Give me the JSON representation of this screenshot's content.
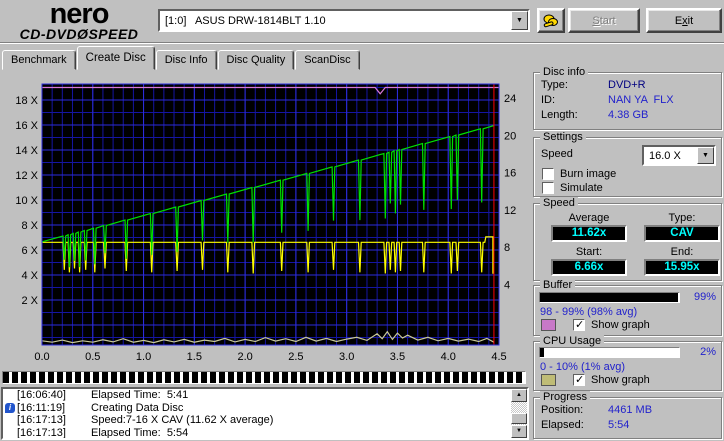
{
  "toolbar": {
    "logo_line1": "nero",
    "logo_line2_left": "CD-DVD",
    "logo_disc_glyph": "Ø",
    "logo_line2_right": "SPEED",
    "drive_select_value": "[1:0]   ASUS DRW-1814BLT 1.10",
    "dropdown_arrow": "▼",
    "start_underline": "S",
    "start_rest": "tart",
    "exit_prefix": "E",
    "exit_underline": "x",
    "exit_rest": "it"
  },
  "tabs": [
    {
      "label": "Benchmark",
      "active": false
    },
    {
      "label": "Create Disc",
      "active": true
    },
    {
      "label": "Disc Info",
      "active": false
    },
    {
      "label": "Disc Quality",
      "active": false
    },
    {
      "label": "ScanDisc",
      "active": false
    }
  ],
  "chart_data": {
    "type": "line",
    "title": "",
    "x_range": [
      0,
      4.5
    ],
    "x_unit": "GB",
    "x_ticks": [
      [
        0,
        "0.0"
      ],
      [
        0.5,
        "0.5"
      ],
      [
        1,
        "1.0"
      ],
      [
        1.5,
        "1.5"
      ],
      [
        2,
        "2.0"
      ],
      [
        2.5,
        "2.5"
      ],
      [
        3,
        "3.0"
      ],
      [
        3.5,
        "3.5"
      ],
      [
        4,
        "4.0"
      ],
      [
        4.5,
        "4.5"
      ]
    ],
    "left_ticks": [
      [
        2,
        "2 X"
      ],
      [
        4,
        "4 X"
      ],
      [
        6,
        "6 X"
      ],
      [
        8,
        "8 X"
      ],
      [
        10,
        "10 X"
      ],
      [
        12,
        "12 X"
      ],
      [
        14,
        "14 X"
      ],
      [
        16,
        "16 X"
      ],
      [
        18,
        "18 X"
      ]
    ],
    "right_ticks": [
      [
        4,
        "4"
      ],
      [
        8,
        "8"
      ],
      [
        12,
        "12"
      ],
      [
        16,
        "16"
      ],
      [
        20,
        "20"
      ],
      [
        24,
        "24"
      ]
    ],
    "grid": {
      "bg": "#000000",
      "minor_x": 0.1,
      "major_x": 0.5,
      "minor_y": 1,
      "major_y": 2,
      "minor_color": "#1515a2",
      "major_color": "#2d2dde"
    },
    "marker": {
      "x": 4.45,
      "color": "#ff0000"
    },
    "series": [
      {
        "name": "write-speed",
        "color": "#00e000",
        "base_start": [
          0,
          6.66
        ],
        "base_end": [
          4.45,
          15.95
        ],
        "dips": [
          [
            0.22,
            1.9
          ],
          [
            0.27,
            2.6
          ],
          [
            0.32,
            2.2
          ],
          [
            0.37,
            2.8
          ],
          [
            0.43,
            2.4
          ],
          [
            0.52,
            2.9
          ],
          [
            0.62,
            2.2
          ],
          [
            0.83,
            3.1
          ],
          [
            1.08,
            3.3
          ],
          [
            1.33,
            3.6
          ],
          [
            1.58,
            3.2
          ],
          [
            1.83,
            3.9
          ],
          [
            2.08,
            4.4
          ],
          [
            2.36,
            4.2
          ],
          [
            2.62,
            4.6
          ],
          [
            2.87,
            4.3
          ],
          [
            3.13,
            4.8
          ],
          [
            3.38,
            5.2
          ],
          [
            3.43,
            4.1
          ],
          [
            3.48,
            5.0
          ],
          [
            3.53,
            4.4
          ],
          [
            3.76,
            5.3
          ],
          [
            4.03,
            5.8
          ],
          [
            4.09,
            5.2
          ],
          [
            4.33,
            5.9
          ]
        ],
        "tail": []
      },
      {
        "name": "reference-speed",
        "color": "#ffff00",
        "base_start": [
          0,
          6.62
        ],
        "base_end": [
          4.36,
          6.62
        ],
        "dips": [
          [
            0.22,
            2.2
          ],
          [
            0.27,
            2.4
          ],
          [
            0.32,
            2.1
          ],
          [
            0.37,
            2.4
          ],
          [
            0.43,
            2.2
          ],
          [
            0.52,
            2.4
          ],
          [
            0.62,
            2.1
          ],
          [
            0.83,
            2.3
          ],
          [
            1.08,
            2.4
          ],
          [
            1.33,
            2.3
          ],
          [
            1.58,
            2.2
          ],
          [
            1.83,
            2.4
          ],
          [
            2.08,
            2.5
          ],
          [
            2.36,
            2.3
          ],
          [
            2.62,
            2.4
          ],
          [
            2.87,
            2.2
          ],
          [
            3.13,
            2.4
          ],
          [
            3.38,
            2.5
          ],
          [
            3.43,
            2.2
          ],
          [
            3.48,
            2.4
          ],
          [
            3.53,
            2.3
          ],
          [
            3.76,
            2.4
          ],
          [
            4.03,
            2.5
          ],
          [
            4.09,
            2.3
          ],
          [
            4.33,
            2.4
          ]
        ],
        "tail": [
          [
            4.37,
            7.05
          ],
          [
            4.44,
            7.05
          ],
          [
            4.44,
            4.1
          ]
        ]
      }
    ],
    "buffer_series": {
      "name": "buffer-level",
      "color": "#d878d8",
      "points": [
        [
          0,
          19.0
        ],
        [
          3.28,
          19.0
        ],
        [
          3.33,
          18.5
        ],
        [
          3.38,
          19.0
        ],
        [
          4.5,
          19.0
        ]
      ]
    },
    "cpu_series": {
      "name": "cpu-usage",
      "color": "#c8c89a",
      "unit": "%",
      "points": [
        [
          0,
          1.2
        ],
        [
          0.1,
          0.8
        ],
        [
          0.2,
          1.4
        ],
        [
          0.3,
          0.7
        ],
        [
          0.4,
          1.2
        ],
        [
          0.5,
          0.8
        ],
        [
          0.6,
          1.5
        ],
        [
          0.7,
          0.9
        ],
        [
          0.8,
          1.8
        ],
        [
          0.9,
          0.8
        ],
        [
          1,
          1.3
        ],
        [
          1.1,
          0.7
        ],
        [
          1.2,
          1.5
        ],
        [
          1.3,
          0.9
        ],
        [
          1.4,
          1.6
        ],
        [
          1.5,
          0.8
        ],
        [
          1.6,
          1.4
        ],
        [
          1.7,
          1.0
        ],
        [
          1.8,
          1.9
        ],
        [
          1.9,
          0.9
        ],
        [
          2,
          1.6
        ],
        [
          2.1,
          1.0
        ],
        [
          2.2,
          2.1
        ],
        [
          2.3,
          1.1
        ],
        [
          2.4,
          1.8
        ],
        [
          2.5,
          1.0
        ],
        [
          2.6,
          2.2
        ],
        [
          2.7,
          1.1
        ],
        [
          2.8,
          1.9
        ],
        [
          2.9,
          1.0
        ],
        [
          3,
          1.7
        ],
        [
          3.1,
          2.2
        ],
        [
          3.2,
          1.3
        ],
        [
          3.3,
          3.2
        ],
        [
          3.35,
          1.8
        ],
        [
          3.4,
          3.8
        ],
        [
          3.45,
          1.6
        ],
        [
          3.5,
          3.4
        ],
        [
          3.55,
          2.0
        ],
        [
          3.6,
          2.8
        ],
        [
          3.7,
          1.4
        ],
        [
          3.8,
          2.2
        ],
        [
          3.9,
          1.2
        ],
        [
          4,
          1.9
        ],
        [
          4.1,
          1.1
        ],
        [
          4.2,
          1.7
        ],
        [
          4.3,
          1.0
        ],
        [
          4.38,
          1.9
        ],
        [
          4.45,
          0.8
        ]
      ]
    }
  },
  "panels": {
    "disc_info": {
      "title": "Disc info",
      "type_label": "Type:",
      "type_value": "DVD+R",
      "id_label": "ID:",
      "id_value": "NAN YA  FLX",
      "length_label": "Length:",
      "length_value": "4.38 GB"
    },
    "settings": {
      "title": "Settings",
      "speed_label": "Speed",
      "speed_value": "16.0 X",
      "dropdown_arrow": "▼",
      "burn_image_label": "Burn image",
      "burn_image_checked": false,
      "simulate_label": "Simulate",
      "simulate_checked": false
    },
    "speed": {
      "title": "Speed",
      "average_label": "Average",
      "average_value": "11.62x",
      "type_label": "Type:",
      "type_value": "CAV",
      "start_label": "Start:",
      "start_value": "6.66x",
      "end_label": "End:",
      "end_value": "15.95x",
      "value_color": "#00ffff"
    },
    "buffer": {
      "title": "Buffer",
      "percent_label": "99%",
      "fill_percent": 99,
      "range_text": "98 - 99% (98% avg)",
      "legend_color": "#c878c8",
      "show_graph_label": "Show graph",
      "show_graph_checked": true
    },
    "cpu": {
      "title": "CPU Usage",
      "percent_label": "2%",
      "fill_percent": 3,
      "range_text": "0 - 10% (1% avg)",
      "legend_color": "#bfbc76",
      "show_graph_label": "Show graph",
      "show_graph_checked": true
    },
    "progress": {
      "title": "Progress",
      "position_label": "Position:",
      "position_value": "4461 MB",
      "elapsed_label": "Elapsed:",
      "elapsed_value": "5:54"
    }
  },
  "log": {
    "entries": [
      {
        "time": "[16:06:40]",
        "text": "Elapsed Time:  5:41",
        "has_icon": false
      },
      {
        "time": "[16:11:19]",
        "text": "Creating Data Disc",
        "has_icon": true
      },
      {
        "time": "[16:17:13]",
        "text": "Speed:7-16 X CAV (11.62 X average)",
        "has_icon": false
      },
      {
        "time": "[16:17:13]",
        "text": "Elapsed Time:  5:54",
        "has_icon": false
      }
    ],
    "scroll_up_arrow": "▲",
    "scroll_down_arrow": "▼"
  }
}
